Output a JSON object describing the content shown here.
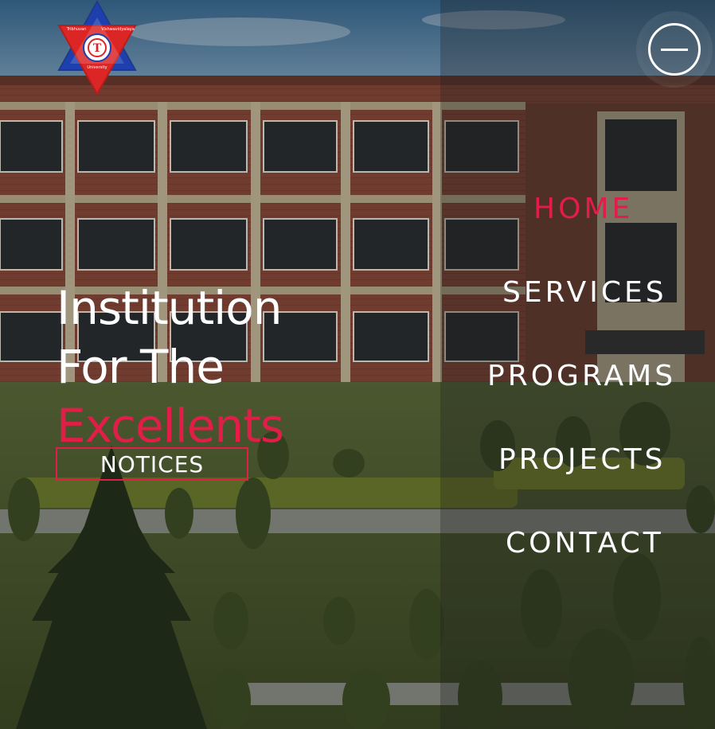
{
  "brand": {
    "logo_text_top_left": "Tribhuvan",
    "logo_text_top_right": "Vishwavidyalaya",
    "logo_text_bottom": "University"
  },
  "menu": {
    "icon": "menu-minus-icon"
  },
  "hero": {
    "line1": "Institution",
    "line2": "For The",
    "line3": "Excellents",
    "notices_label": "NOTICES"
  },
  "nav": {
    "items": [
      {
        "label": "HOME",
        "active": true
      },
      {
        "label": "SERVICES",
        "active": false
      },
      {
        "label": "PROGRAMS",
        "active": false
      },
      {
        "label": "PROJECTS",
        "active": false
      },
      {
        "label": "CONTACT",
        "active": false
      }
    ]
  },
  "colors": {
    "accent": "#e11d48",
    "text": "#ffffff",
    "logo_blue": "#1e40af",
    "logo_red": "#dc2626"
  }
}
